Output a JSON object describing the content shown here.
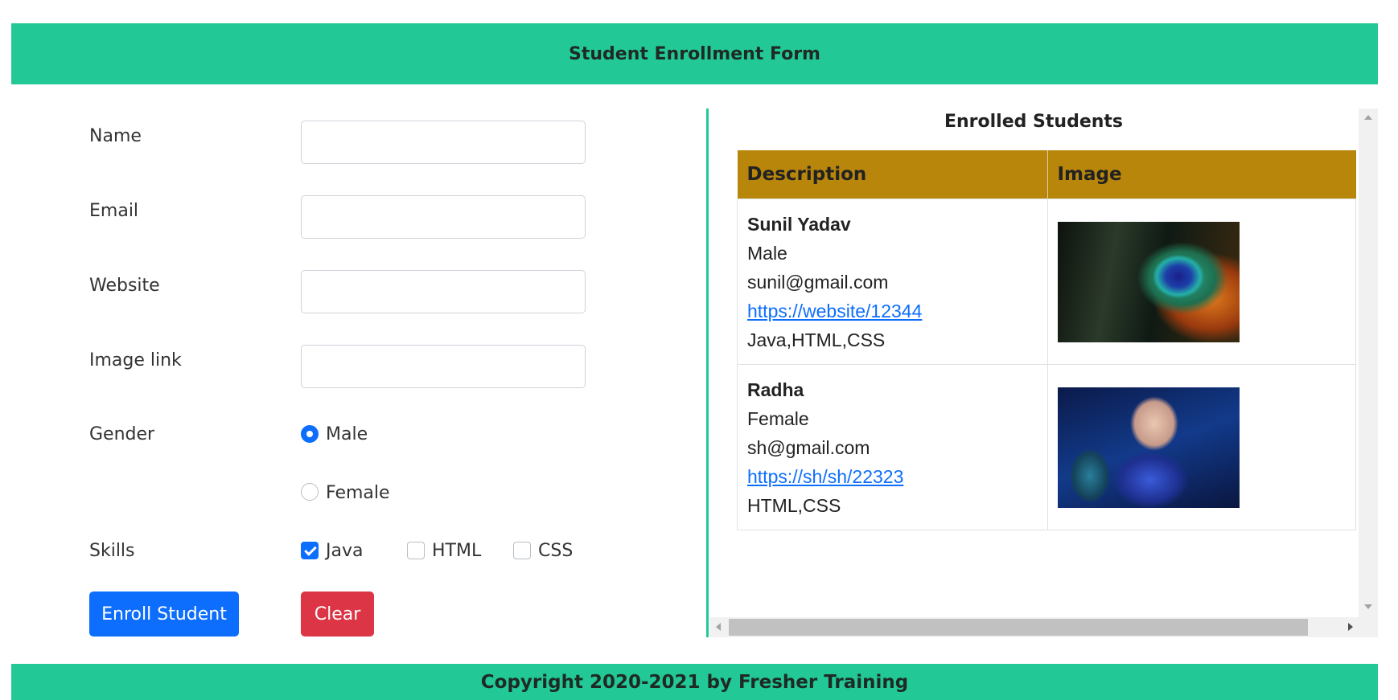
{
  "header": {
    "title": "Student Enrollment Form"
  },
  "form": {
    "name_label": "Name",
    "email_label": "Email",
    "website_label": "Website",
    "image_link_label": "Image link",
    "gender_label": "Gender",
    "gender_options": [
      {
        "label": "Male",
        "checked": true
      },
      {
        "label": "Female",
        "checked": false
      }
    ],
    "skills_label": "Skills",
    "skills_options": [
      {
        "label": "Java",
        "checked": true
      },
      {
        "label": "HTML",
        "checked": false
      },
      {
        "label": "CSS",
        "checked": false
      }
    ],
    "enroll_button": "Enroll Student",
    "clear_button": "Clear"
  },
  "enrolled": {
    "title": "Enrolled Students",
    "columns": [
      "Description",
      "Image"
    ],
    "rows": [
      {
        "name": "Sunil Yadav",
        "gender": "Male",
        "email": "sunil@gmail.com",
        "website": "https://website/12344",
        "skills": "Java,HTML,CSS"
      },
      {
        "name": "Radha",
        "gender": "Female",
        "email": "sh@gmail.com",
        "website": "https://sh/sh/22323",
        "skills": "HTML,CSS"
      }
    ]
  },
  "footer": {
    "text": "Copyright 2020-2021 by Fresher Training"
  },
  "colors": {
    "header_bg": "#22c997",
    "table_header_bg": "#b8860b",
    "primary": "#0d6efd",
    "danger": "#dc3545"
  }
}
